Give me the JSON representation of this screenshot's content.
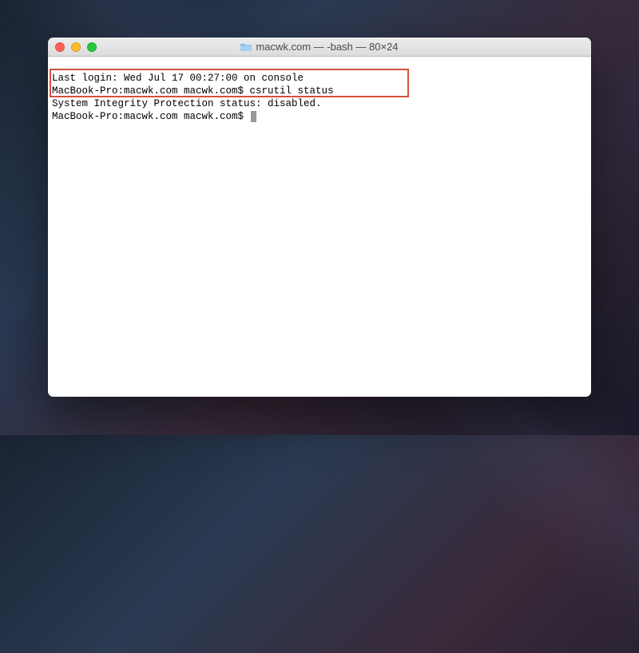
{
  "window": {
    "title_folder": "macwk.com",
    "title_suffix": " — -bash — 80×24"
  },
  "terminal": {
    "line1": "Last login: Wed Jul 17 00:27:00 on console",
    "line2_prompt": "MacBook-Pro:macwk.com macwk.com$ ",
    "line2_cmd": "csrutil status",
    "line3": "System Integrity Protection status: disabled.",
    "line4_prompt": "MacBook-Pro:macwk.com macwk.com$ "
  }
}
